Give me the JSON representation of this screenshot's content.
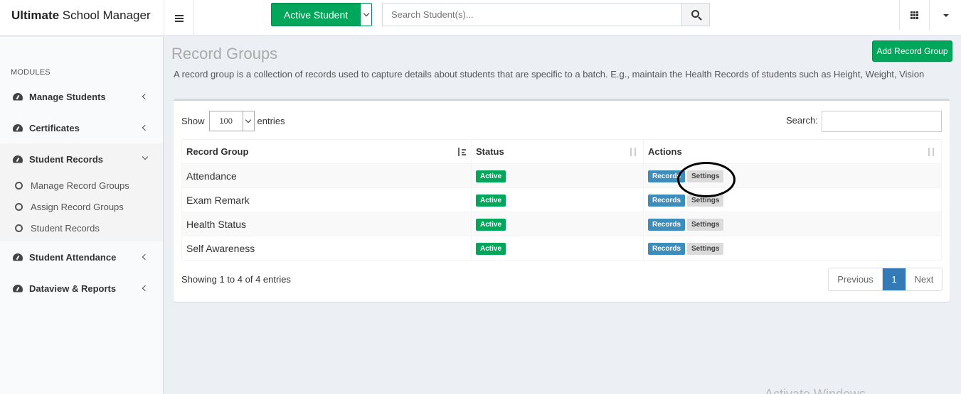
{
  "brand": {
    "bold": "Ultimate",
    "rest": " School Manager"
  },
  "topbar": {
    "active_button_label": "Active Student",
    "search_placeholder": "Search Student(s)...",
    "icons": [
      "hamburger-icon",
      "chevron-down-icon",
      "search-icon",
      "apps-grid-icon",
      "caret-down-icon"
    ]
  },
  "sidebar": {
    "section_label": "MODULES",
    "items": [
      {
        "label": "Manage Students",
        "open": false
      },
      {
        "label": "Certificates",
        "open": false
      },
      {
        "label": "Student Records",
        "open": true
      },
      {
        "label": "Student Attendance",
        "open": false
      },
      {
        "label": "Dataview & Reports",
        "open": false
      }
    ],
    "subitems": [
      {
        "label": "Manage Record Groups"
      },
      {
        "label": "Assign Record Groups"
      },
      {
        "label": "Student Records"
      }
    ]
  },
  "page": {
    "title": "Record Groups",
    "add_button": "Add Record Group",
    "description": "A record group is a collection of records used to capture details about students that are specific to a batch. E.g., maintain the Health Records of students such as Height, Weight, Vision"
  },
  "table": {
    "show_label": "Show",
    "entries_value": "100",
    "entries_label": "entries",
    "search_label": "Search:",
    "columns": [
      "Record Group",
      "Status",
      "Actions"
    ],
    "rows": [
      {
        "group": "Attendance",
        "status": "Active",
        "action_records": "Records",
        "action_settings": "Settings"
      },
      {
        "group": "Exam Remark",
        "status": "Active",
        "action_records": "Records",
        "action_settings": "Settings"
      },
      {
        "group": "Health Status",
        "status": "Active",
        "action_records": "Records",
        "action_settings": "Settings"
      },
      {
        "group": "Self Awareness",
        "status": "Active",
        "action_records": "Records",
        "action_settings": "Settings"
      }
    ],
    "info": "Showing 1 to 4 of 4 entries",
    "pagination": {
      "previous": "Previous",
      "current": "1",
      "next": "Next"
    }
  },
  "colors": {
    "green": "#00a65a",
    "blue": "#3c8dbc",
    "pager_active": "#337ab7"
  },
  "watermark": "Activate Windows"
}
